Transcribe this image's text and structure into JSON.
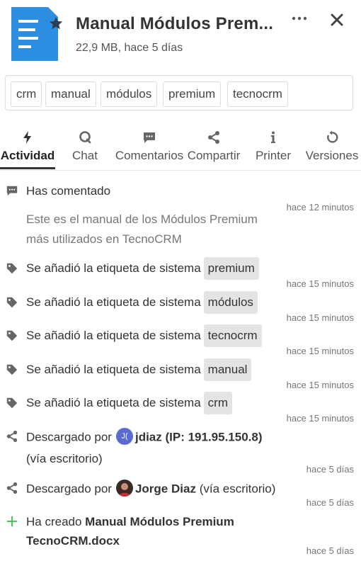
{
  "header": {
    "title": "Manual Módulos Prem...",
    "meta": "22,9 MB, hace 5 días",
    "more_label": "···"
  },
  "tags": [
    "crm",
    "manual",
    "módulos",
    "premium",
    "tecnocrm"
  ],
  "tabs": [
    {
      "label": "Actividad",
      "icon": "bolt-icon",
      "active": true
    },
    {
      "label": "Chat",
      "icon": "chat-icon"
    },
    {
      "label": "Comentarios",
      "icon": "comment-icon"
    },
    {
      "label": "Compartir",
      "icon": "share-icon"
    },
    {
      "label": "Printer",
      "icon": "info-icon"
    },
    {
      "label": "Versiones",
      "icon": "history-icon"
    }
  ],
  "activity": {
    "comment": {
      "label": "Has comentado",
      "body_line1": "Este es el manual de los Módulos Premium",
      "body_line2": "más utilizados en TecnoCRM",
      "time": "hace 12 minutos"
    },
    "tag_prefix": "Se añadió la etiqueta de sistema",
    "tag_events": [
      {
        "tag": "premium",
        "time": "hace 15 minutos"
      },
      {
        "tag": "módulos",
        "time": "hace 15 minutos"
      },
      {
        "tag": "tecnocrm",
        "time": "hace 15 minutos"
      },
      {
        "tag": "manual",
        "time": "hace 15 minutos"
      },
      {
        "tag": "crm",
        "time": "hace 15 minutos"
      }
    ],
    "download1": {
      "prefix": "Descargado por",
      "avatar_initials": "J(",
      "user": "jdiaz (IP: 191.95.150.8)",
      "suffix": "(vía escritorio)",
      "time": "hace 5 días"
    },
    "download2": {
      "prefix": "Descargado por",
      "user": "Jorge Diaz",
      "suffix": "(vía escritorio)",
      "time": "hace 5 días"
    },
    "created": {
      "prefix": "Ha creado",
      "file_line1": "Manual Módulos Premium",
      "file_line2": "TecnoCRM.docx",
      "time": "hace 5 días"
    }
  },
  "colors": {
    "file_icon": "#2b8ee0",
    "avatar_jdiaz": "#5a6ad0",
    "plus_green": "#4cc36a",
    "pill_bg": "#e4e4e4"
  }
}
